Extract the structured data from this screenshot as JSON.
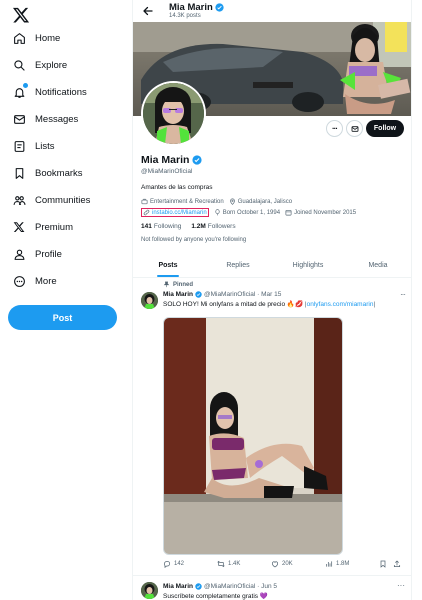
{
  "nav": {
    "items": [
      {
        "label": "Home",
        "icon": "home-icon"
      },
      {
        "label": "Explore",
        "icon": "search-icon"
      },
      {
        "label": "Notifications",
        "icon": "bell-icon"
      },
      {
        "label": "Messages",
        "icon": "mail-icon"
      },
      {
        "label": "Lists",
        "icon": "list-icon"
      },
      {
        "label": "Bookmarks",
        "icon": "bookmark-icon"
      },
      {
        "label": "Communities",
        "icon": "people-icon"
      },
      {
        "label": "Premium",
        "icon": "x-logo-icon"
      },
      {
        "label": "Profile",
        "icon": "person-icon"
      },
      {
        "label": "More",
        "icon": "more-circle-icon"
      }
    ],
    "post_label": "Post"
  },
  "header": {
    "name": "Mia Marin",
    "posts_count": "14.3K posts"
  },
  "profile": {
    "follow_label": "Follow",
    "name": "Mia Marin",
    "handle": "@MiaMarinOficial",
    "bio": "Amantes de las compras",
    "category": "Entertainment & Recreation",
    "location": "Guadalajara, Jalisco",
    "link": "instabio.cc/Miamarin",
    "born": "Born October 1, 1994",
    "joined": "Joined November 2015",
    "following_count": "141",
    "following_label": "Following",
    "followers_count": "1.2M",
    "followers_label": "Followers",
    "followed_by": "Not followed by anyone you're following"
  },
  "tabs": [
    "Posts",
    "Replies",
    "Highlights",
    "Media"
  ],
  "tweets": [
    {
      "pinned_label": "Pinned",
      "name": "Mia Marin",
      "handle_date": "@MiaMarinOficial · Mar 15",
      "text": "SOLO HOY! Mi onlyfans a mitad de precio 🔥💋 ",
      "link": "onlyfans.com/miamarin",
      "replies": "142",
      "reposts": "1.4K",
      "likes": "20K",
      "views": "1.8M"
    },
    {
      "name": "Mia Marin",
      "handle_date": "@MiaMarinOficial · Jun 5",
      "text": "Suscríbete completamente gratis 💜"
    }
  ],
  "colors": {
    "accent": "#1d9bf0",
    "text": "#0f1419",
    "muted": "#536471",
    "highlight_box": "#e0245e"
  }
}
